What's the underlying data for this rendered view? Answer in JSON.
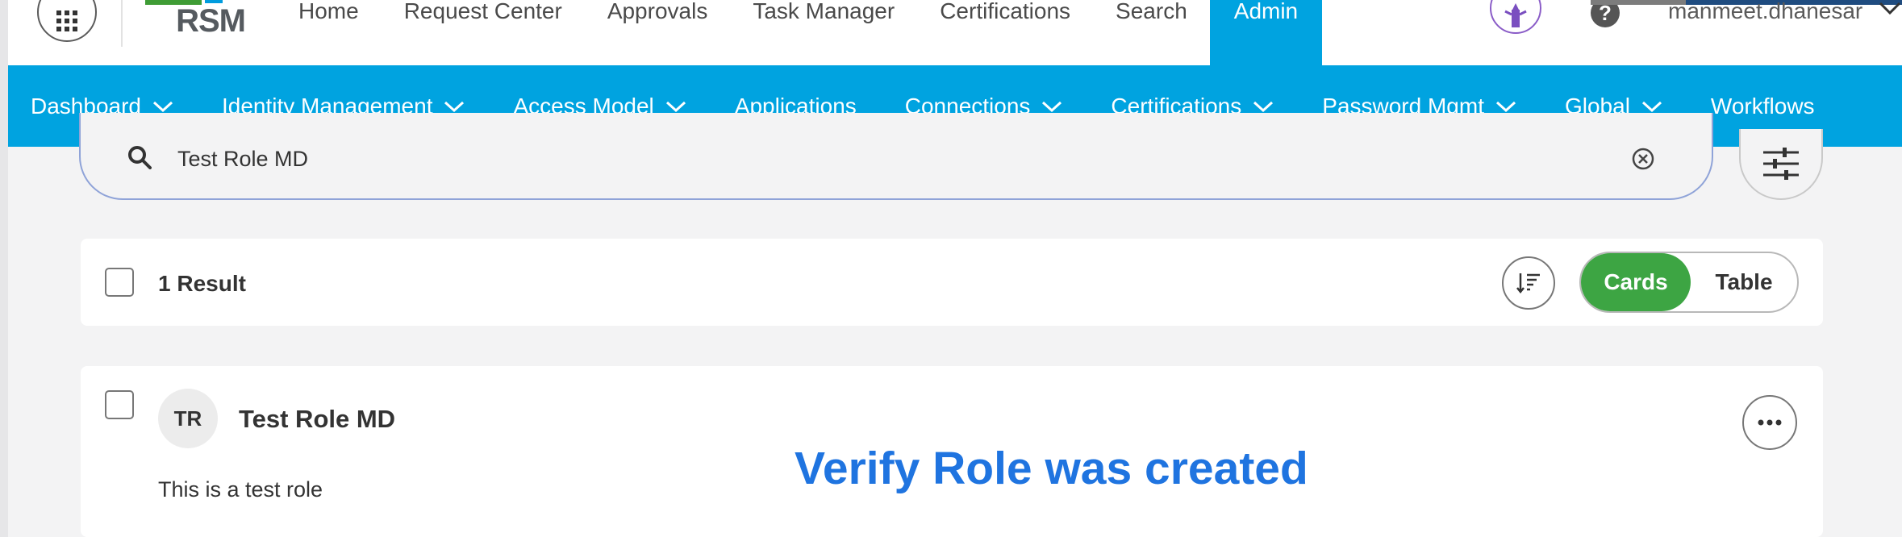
{
  "header": {
    "logo_text": "RSM",
    "nav": [
      "Home",
      "Request Center",
      "Approvals",
      "Task Manager",
      "Certifications",
      "Search",
      "Admin"
    ],
    "active_nav": "Admin",
    "username": "manmeet.dhanesar"
  },
  "subnav": {
    "items": [
      {
        "label": "Dashboard",
        "dropdown": true
      },
      {
        "label": "Identity Management",
        "dropdown": true
      },
      {
        "label": "Access Model",
        "dropdown": true,
        "active": true
      },
      {
        "label": "Applications",
        "dropdown": false
      },
      {
        "label": "Connections",
        "dropdown": true
      },
      {
        "label": "Certifications",
        "dropdown": true
      },
      {
        "label": "Password Mgmt",
        "dropdown": true
      },
      {
        "label": "Global",
        "dropdown": true
      },
      {
        "label": "Workflows",
        "dropdown": false
      }
    ]
  },
  "search": {
    "value": "Test Role MD"
  },
  "results": {
    "count_label": "1 Result",
    "view_cards": "Cards",
    "view_table": "Table",
    "selected_view": "Cards"
  },
  "card": {
    "avatar_initials": "TR",
    "title": "Test Role MD",
    "description": "This is a test role"
  },
  "annotation": "Verify Role was created",
  "colors": {
    "primary_blue": "#00a3e0",
    "toggle_green": "#3da543",
    "annotation_blue": "#1f74e0"
  }
}
